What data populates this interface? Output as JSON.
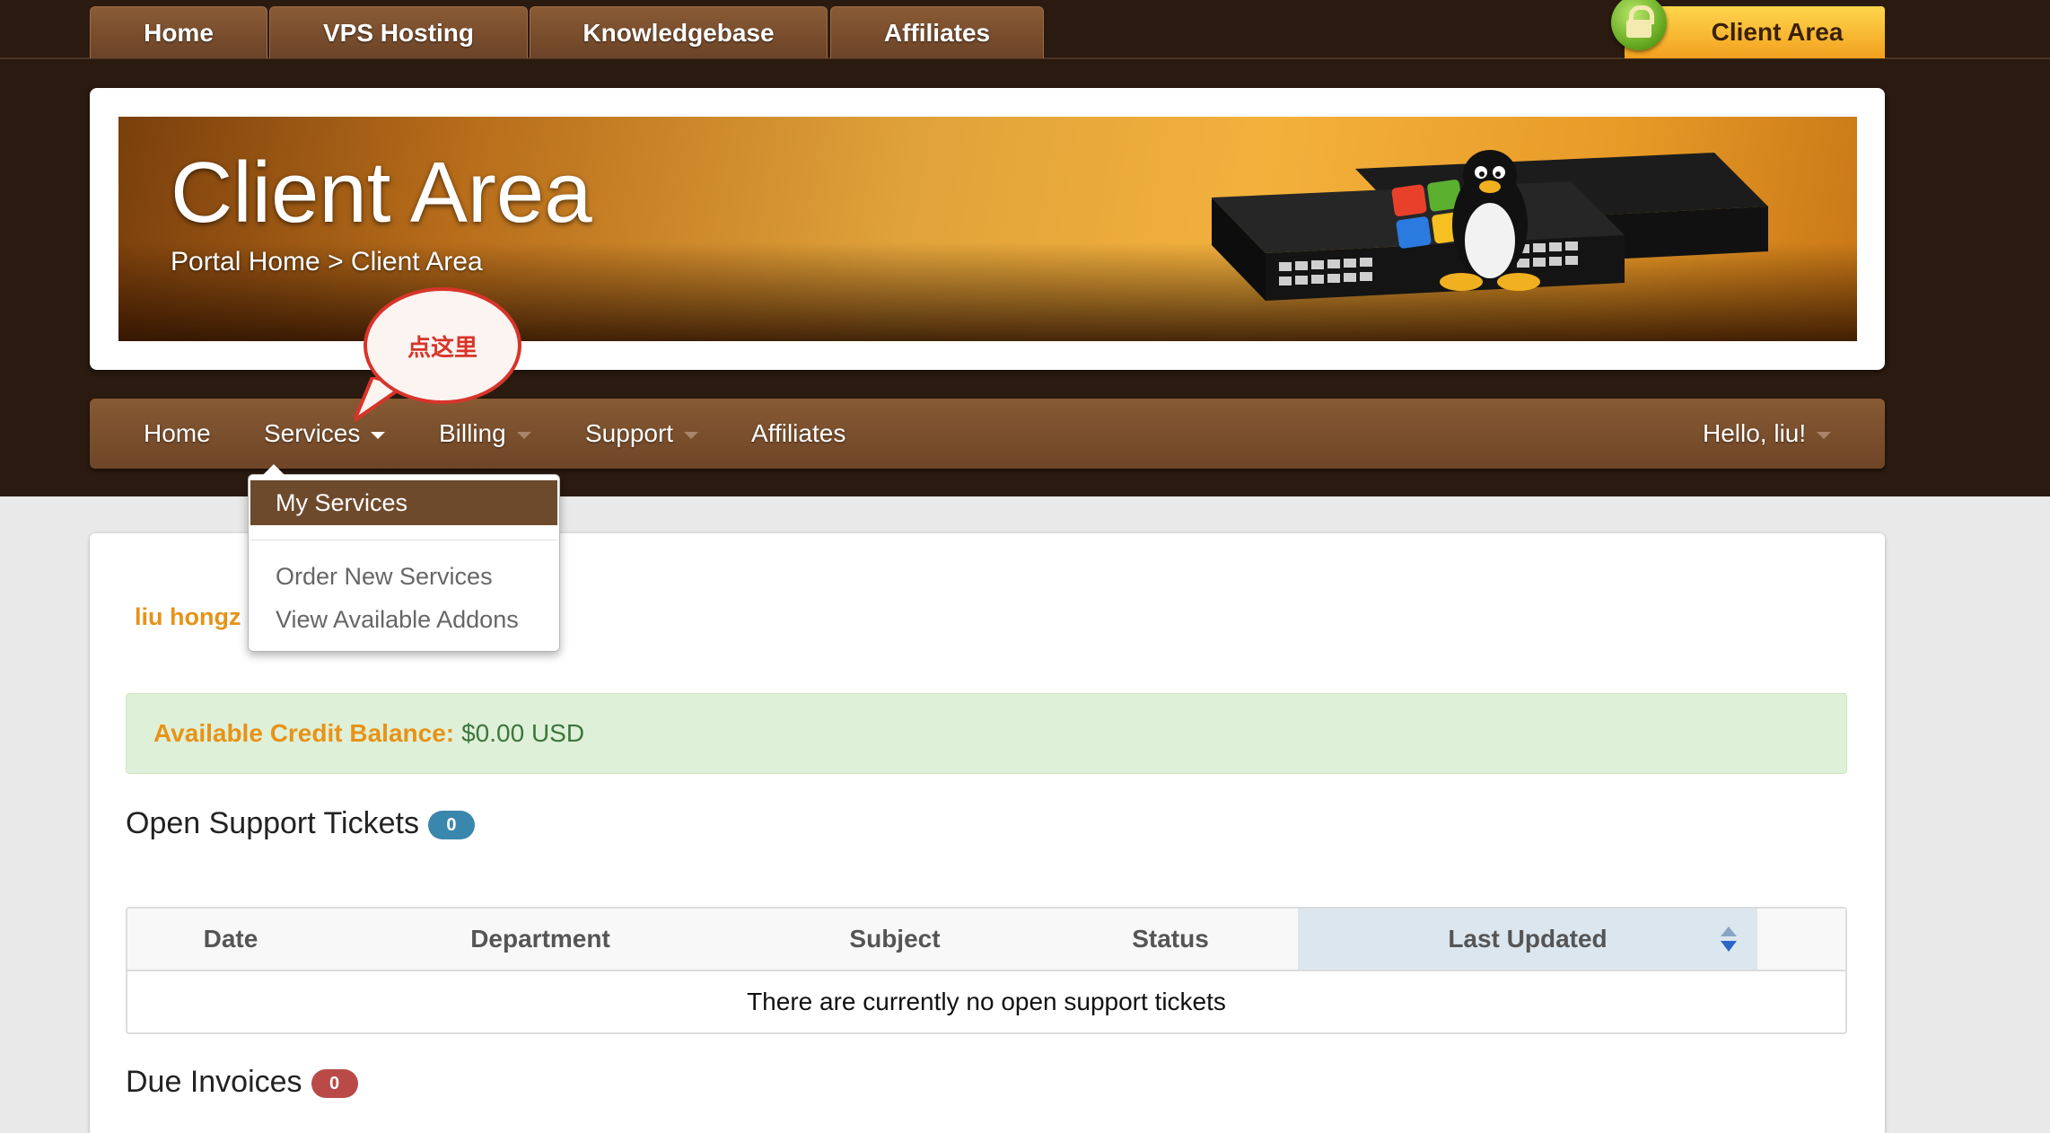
{
  "top_nav": {
    "tabs": [
      "Home",
      "VPS Hosting",
      "Knowledgebase",
      "Affiliates"
    ],
    "client_area": "Client Area"
  },
  "banner": {
    "title": "Client Area",
    "breadcrumb": "Portal Home > Client Area"
  },
  "callout": {
    "text": "点这里"
  },
  "main_nav": {
    "home": "Home",
    "services": "Services",
    "billing": "Billing",
    "support": "Support",
    "affiliates": "Affiliates",
    "user": "Hello, liu!"
  },
  "services_menu": {
    "active": "My Services",
    "items": [
      "Order New Services",
      "View Available Addons"
    ]
  },
  "content": {
    "username": "liu hongz",
    "credit_label": "Available Credit Balance:",
    "credit_value": "$0.00 USD",
    "tickets": {
      "title": "Open Support Tickets",
      "count": "0",
      "columns": [
        "Date",
        "Department",
        "Subject",
        "Status",
        "Last Updated"
      ],
      "empty_message": "There are currently no open support tickets"
    },
    "invoices": {
      "title": "Due Invoices",
      "count": "0"
    }
  },
  "colors": {
    "header_bg": "#2a1a10",
    "nav_brown": "#7a4e2d",
    "client_area_gold": "#f5b72e",
    "highlight_orange": "#e69318",
    "success_bg": "#dff0d8",
    "badge_blue": "#3a87ad",
    "badge_red": "#b94a48",
    "callout_red": "#d8342a"
  },
  "icons": [
    "lock-icon",
    "sort-icon",
    "caret-down-icon"
  ]
}
